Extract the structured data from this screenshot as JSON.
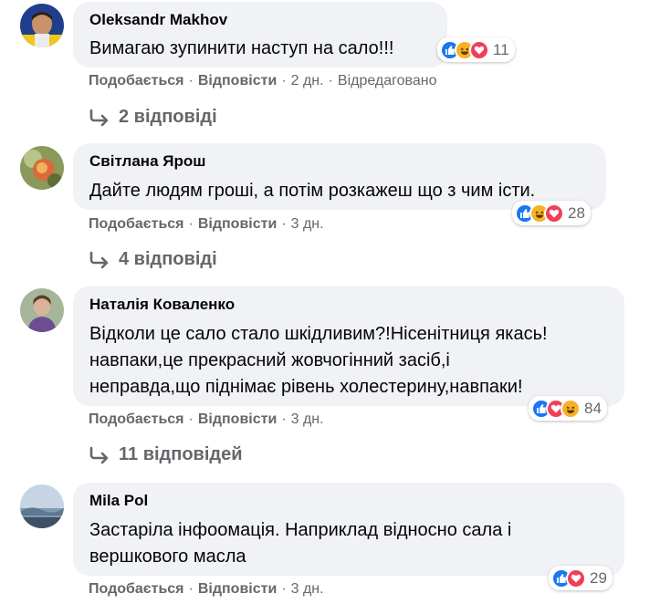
{
  "labels": {
    "like": "Подобається",
    "reply": "Відповісти",
    "dot": "·"
  },
  "colors": {
    "bubble": "#f0f2f5",
    "secondary_text": "#65676b",
    "like": "#1877f2",
    "haha": "#f7b125",
    "love": "#f33e58"
  },
  "comments": [
    {
      "author": "Oleksandr Makhov",
      "lines": [
        "Вимагаю зупинити наступ на сало!!!"
      ],
      "reactions": [
        "like-icon",
        "haha-icon",
        "love-icon"
      ],
      "reaction_count": "11",
      "time": "2 дн.",
      "edited": "Відредаговано",
      "replies": "2 відповіді"
    },
    {
      "author": "Світлана Ярош",
      "lines": [
        "Дайте людям гроші, а потім розкажеш що з чим істи."
      ],
      "reactions": [
        "like-icon",
        "haha-icon",
        "love-icon"
      ],
      "reaction_count": "28",
      "time": "3 дн.",
      "replies": "4 відповіді"
    },
    {
      "author": "Наталія Коваленко",
      "lines": [
        "Відколи це сало стало шкідливим?!Нісенітниця якась!",
        "навпаки,це прекрасний жовчогінний засіб,і",
        "неправда,що піднімає рівень холестерину,навпаки!"
      ],
      "reactions": [
        "like-icon",
        "love-icon",
        "haha-icon"
      ],
      "reaction_count": "84",
      "time": "3 дн.",
      "replies": "11 відповідей"
    },
    {
      "author": "Mila Pol",
      "lines": [
        "Застаріла інфоомація. Наприклад відносно сала і",
        "вершкового масла"
      ],
      "reactions": [
        "like-icon",
        "love-icon"
      ],
      "reaction_count": "29",
      "time": "3 дн."
    }
  ]
}
